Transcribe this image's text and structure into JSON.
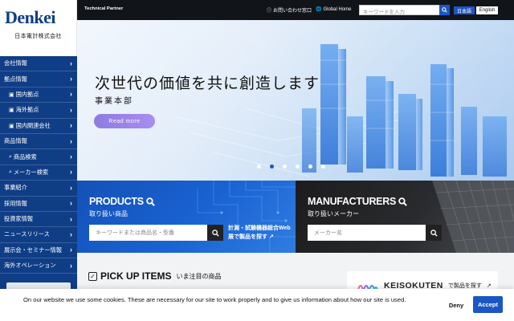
{
  "brand": {
    "logo": "Denkei",
    "company": "日本電計株式会社"
  },
  "sidebar": {
    "items": [
      {
        "label": "会社情報",
        "sub": false,
        "icon": ""
      },
      {
        "label": "拠点情報",
        "sub": false,
        "icon": ""
      },
      {
        "label": "国内拠点",
        "sub": true,
        "icon": "building-icon"
      },
      {
        "label": "海外拠点",
        "sub": true,
        "icon": "building-icon"
      },
      {
        "label": "国内関連会社",
        "sub": true,
        "icon": "building-icon"
      },
      {
        "label": "商品情報",
        "sub": false,
        "icon": ""
      },
      {
        "label": "商品検索",
        "sub": true,
        "icon": "search-icon"
      },
      {
        "label": "メーカー検索",
        "sub": true,
        "icon": "search-icon"
      },
      {
        "label": "事業紹介",
        "sub": false,
        "icon": ""
      },
      {
        "label": "採用情報",
        "sub": false,
        "icon": ""
      },
      {
        "label": "投資家情報",
        "sub": false,
        "icon": ""
      },
      {
        "label": "ニュースリリース",
        "sub": false,
        "icon": ""
      },
      {
        "label": "展示会・セミナー情報",
        "sub": false,
        "icon": ""
      },
      {
        "label": "海外オペレーション",
        "sub": false,
        "icon": ""
      }
    ]
  },
  "topbar": {
    "partner": "Technical Partner",
    "contact": "お問い合わせ窓口",
    "global": "Global Home",
    "search_placeholder": "キーワードを入力",
    "lang_ja": "日本語",
    "lang_en": "English"
  },
  "hero": {
    "title": "次世代の価値を共に創造します",
    "subtitle": "事業本部",
    "button": "Read more",
    "slide_count": 6,
    "active_slide": 2
  },
  "products": {
    "title": "PRODUCTS",
    "subtitle": "取り扱い商品",
    "placeholder": "キーワードまたは商品名・型番",
    "web_link": "計測・試験機器総合Web展で製品を探す"
  },
  "manufacturers": {
    "title": "MANUFACTURERS",
    "subtitle": "取り扱いメーカー",
    "placeholder": "メーカー名"
  },
  "pickup": {
    "title_en": "PICK UP ITEMS",
    "title_ja": "いま注目の商品",
    "keisokuten_logo": "KEISOKUTEN",
    "keisokuten_text": "で製品を探す"
  },
  "cookie": {
    "text": "On our website we use some cookies. These are necessary for our site to work properly and to give us information about how our site is used.",
    "deny": "Deny",
    "accept": "Accept"
  },
  "colors": {
    "brand_blue": "#0f3d86",
    "accent_blue": "#1b56c5",
    "dark": "#111418"
  }
}
